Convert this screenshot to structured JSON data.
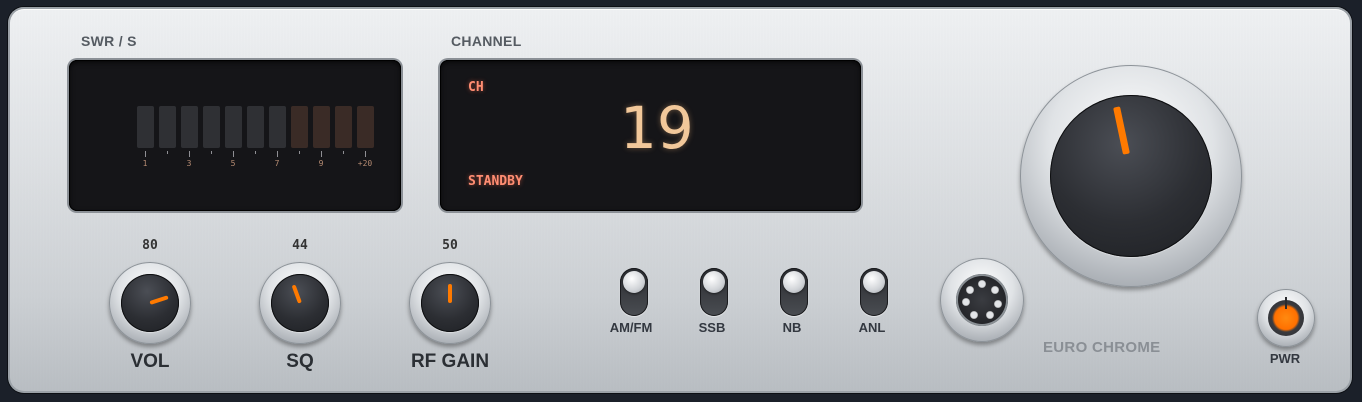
{
  "meter": {
    "label": "SWR / S",
    "active_segments": 0,
    "segment_colors": {
      "normal": "#2f3034",
      "warning": "#3a2b26"
    },
    "tick_labels": [
      "1",
      "3",
      "5",
      "7",
      "9",
      "+20"
    ]
  },
  "channel": {
    "label": "CHANNEL",
    "prefix": "CH",
    "number": "19",
    "status": "STANDBY"
  },
  "knobs": [
    {
      "value": "80",
      "name": "VOL"
    },
    {
      "value": "44",
      "name": "SQ"
    },
    {
      "value": "50",
      "name": "RF GAIN"
    }
  ],
  "switches": [
    {
      "label": "AM/FM"
    },
    {
      "label": "SSB"
    },
    {
      "label": "NB"
    },
    {
      "label": "ANL"
    }
  ],
  "brand": "EURO CHROME",
  "power": {
    "label": "PWR"
  },
  "colors": {
    "accent": "#ff7a00",
    "lcd_text": "#ff8d72",
    "lcd_digits": "#f2c89a"
  }
}
